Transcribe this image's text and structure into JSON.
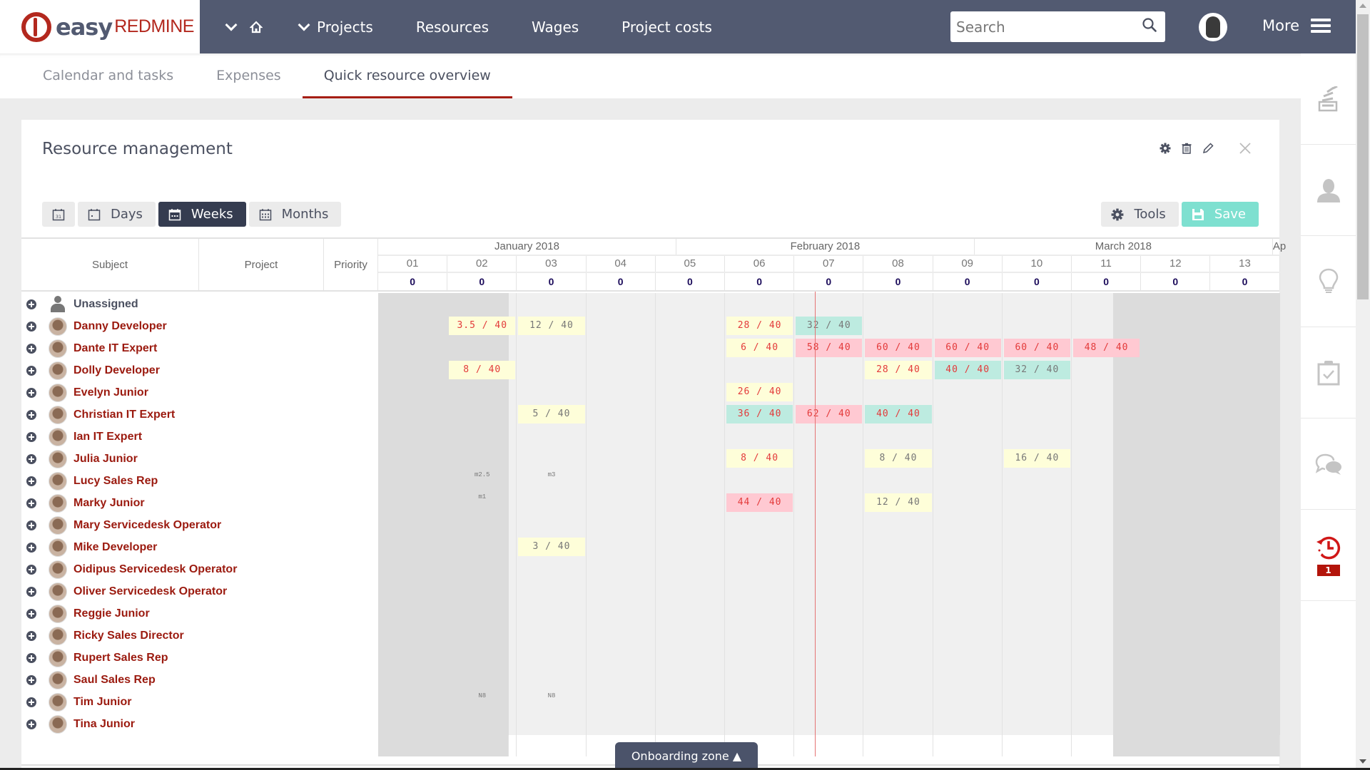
{
  "app": {
    "logo_easy": "easy",
    "logo_redmine": "REDMINE"
  },
  "nav": {
    "items": [
      "Projects",
      "Resources",
      "Wages",
      "Project costs"
    ],
    "more_label": "More"
  },
  "search": {
    "placeholder": "Search",
    "value": ""
  },
  "tabs": [
    {
      "label": "Calendar and tasks",
      "active": false
    },
    {
      "label": "Expenses",
      "active": false
    },
    {
      "label": "Quick resource overview",
      "active": true
    }
  ],
  "panel": {
    "title": "Resource management",
    "view_buttons": {
      "days": "Days",
      "weeks": "Weeks",
      "months": "Months",
      "active": "Weeks"
    },
    "tools_label": "Tools",
    "save_label": "Save"
  },
  "grid": {
    "columns": {
      "subject": "Subject",
      "project": "Project",
      "priority": "Priority"
    },
    "months": [
      {
        "label": "January 2018",
        "weeks": 4.3
      },
      {
        "label": "February 2018",
        "weeks": 4.3
      },
      {
        "label": "March 2018",
        "weeks": 4.3
      },
      {
        "label": "Ap",
        "weeks": 0.1
      }
    ],
    "weeks": [
      "01",
      "02",
      "03",
      "04",
      "05",
      "06",
      "07",
      "08",
      "09",
      "10",
      "11",
      "12",
      "13"
    ],
    "week_totals": [
      "0",
      "0",
      "0",
      "0",
      "0",
      "0",
      "0",
      "0",
      "0",
      "0",
      "0",
      "0",
      "0"
    ],
    "today_week_position": 6.3,
    "users": [
      {
        "name": "Unassigned",
        "unassigned": true,
        "allocations": [],
        "notes": []
      },
      {
        "name": "Danny Developer",
        "allocations": [
          {
            "week": 1,
            "text": "3.5 / 40",
            "bg": "yellow",
            "tone": "over"
          },
          {
            "week": 2,
            "text": "12 / 40",
            "bg": "yellow",
            "tone": "under"
          },
          {
            "week": 5,
            "text": "28 / 40",
            "bg": "yellow",
            "tone": "over"
          },
          {
            "week": 6,
            "text": "32 / 40",
            "bg": "green",
            "tone": "under"
          }
        ],
        "notes": []
      },
      {
        "name": "Dante IT Expert",
        "allocations": [
          {
            "week": 5,
            "text": "6 / 40",
            "bg": "yellow",
            "tone": "over"
          },
          {
            "week": 6,
            "text": "58 / 40",
            "bg": "pink",
            "tone": "over"
          },
          {
            "week": 7,
            "text": "60 / 40",
            "bg": "pink",
            "tone": "over"
          },
          {
            "week": 8,
            "text": "60 / 40",
            "bg": "pink",
            "tone": "over"
          },
          {
            "week": 9,
            "text": "60 / 40",
            "bg": "pink",
            "tone": "over"
          },
          {
            "week": 10,
            "text": "48 / 40",
            "bg": "pink",
            "tone": "over"
          }
        ],
        "notes": []
      },
      {
        "name": "Dolly Developer",
        "allocations": [
          {
            "week": 1,
            "text": "8 / 40",
            "bg": "yellow",
            "tone": "over"
          },
          {
            "week": 7,
            "text": "28 / 40",
            "bg": "yellow",
            "tone": "over"
          },
          {
            "week": 8,
            "text": "40 / 40",
            "bg": "green",
            "tone": "over"
          },
          {
            "week": 9,
            "text": "32 / 40",
            "bg": "green",
            "tone": "under"
          }
        ],
        "notes": []
      },
      {
        "name": "Evelyn Junior",
        "allocations": [
          {
            "week": 5,
            "text": "26 / 40",
            "bg": "yellow",
            "tone": "over"
          }
        ],
        "notes": []
      },
      {
        "name": "Christian IT Expert",
        "allocations": [
          {
            "week": 2,
            "text": "5 / 40",
            "bg": "yellow",
            "tone": "under"
          },
          {
            "week": 5,
            "text": "36 / 40",
            "bg": "green",
            "tone": "over"
          },
          {
            "week": 6,
            "text": "62 / 40",
            "bg": "pink",
            "tone": "over"
          },
          {
            "week": 7,
            "text": "40 / 40",
            "bg": "green",
            "tone": "over"
          }
        ],
        "notes": []
      },
      {
        "name": "Ian IT Expert",
        "allocations": [],
        "notes": []
      },
      {
        "name": "Julia Junior",
        "allocations": [
          {
            "week": 5,
            "text": "8 / 40",
            "bg": "yellow",
            "tone": "over"
          },
          {
            "week": 7,
            "text": "8 / 40",
            "bg": "yellow",
            "tone": "under"
          },
          {
            "week": 9,
            "text": "16 / 40",
            "bg": "yellow",
            "tone": "under"
          }
        ],
        "notes": []
      },
      {
        "name": "Lucy Sales Rep",
        "allocations": [],
        "notes": [
          {
            "week": 1,
            "text": "m2.5"
          },
          {
            "week": 2,
            "text": "m3"
          }
        ]
      },
      {
        "name": "Marky Junior",
        "allocations": [
          {
            "week": 5,
            "text": "44 / 40",
            "bg": "pink",
            "tone": "over"
          },
          {
            "week": 7,
            "text": "12 / 40",
            "bg": "yellow",
            "tone": "under"
          }
        ],
        "notes": [
          {
            "week": 1,
            "text": "m1"
          }
        ]
      },
      {
        "name": "Mary Servicedesk Operator",
        "allocations": [],
        "notes": []
      },
      {
        "name": "Mike Developer",
        "allocations": [
          {
            "week": 2,
            "text": "3 / 40",
            "bg": "yellow",
            "tone": "under"
          }
        ],
        "notes": []
      },
      {
        "name": "Oidipus Servicedesk Operator",
        "allocations": [],
        "notes": []
      },
      {
        "name": "Oliver Servicedesk Operator",
        "allocations": [],
        "notes": []
      },
      {
        "name": "Reggie Junior",
        "allocations": [],
        "notes": []
      },
      {
        "name": "Ricky Sales Director",
        "allocations": [],
        "notes": []
      },
      {
        "name": "Rupert Sales Rep",
        "allocations": [],
        "notes": []
      },
      {
        "name": "Saul Sales Rep",
        "allocations": [],
        "notes": []
      },
      {
        "name": "Tim Junior",
        "allocations": [],
        "notes": [
          {
            "week": 1,
            "text": "N8"
          },
          {
            "week": 2,
            "text": "N8"
          }
        ]
      },
      {
        "name": "Tina Junior",
        "allocations": [],
        "notes": []
      }
    ]
  },
  "onboarding": {
    "label": "Onboarding zone ▲"
  },
  "sidebar": {
    "items": [
      "activity-stream",
      "user",
      "ideas",
      "tasks",
      "chat",
      "recent-history"
    ],
    "history_badge": "1"
  },
  "colors": {
    "brand_red": "#b3281e",
    "topbar": "#525a71",
    "save_green": "#7ee0d0",
    "over_text": "#e33a3a"
  }
}
